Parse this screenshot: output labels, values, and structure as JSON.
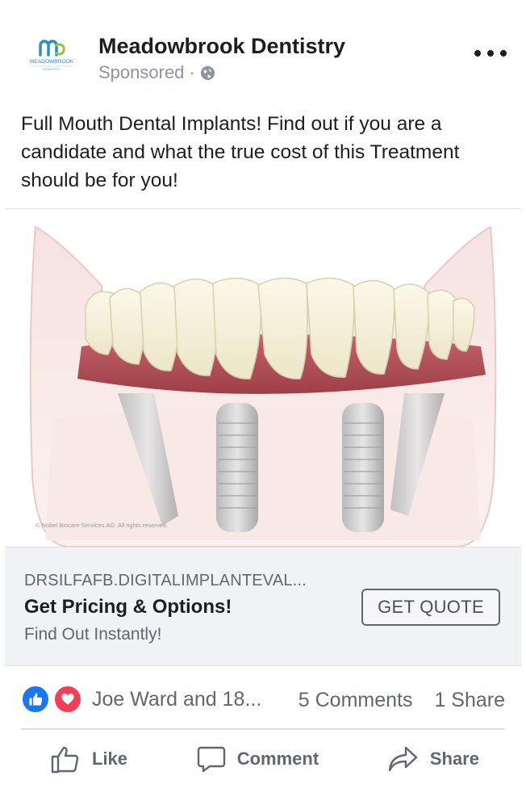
{
  "page": {
    "name": "Meadowbrook Dentistry",
    "sponsored_label": "Sponsored",
    "separator": "·",
    "logo_text": "MEADOWBROOK",
    "logo_subtext": "DENTISTRY"
  },
  "post": {
    "text": "Full Mouth Dental Implants! Find out if you are a candidate and what the true cost of this Treatment should be for you!"
  },
  "media": {
    "copyright": "© Nobel Biocare Services AG. All rights reserved."
  },
  "link": {
    "domain": "DRSILFAFB.DIGITALIMPLANTEVAL...",
    "title": "Get Pricing & Options!",
    "description": "Find Out Instantly!",
    "cta_label": "GET QUOTE"
  },
  "engagement": {
    "reaction_names": "Joe Ward and 18...",
    "comments": "5 Comments",
    "shares": "1 Share"
  },
  "actions": {
    "like": "Like",
    "comment": "Comment",
    "share": "Share"
  },
  "colors": {
    "brand_blue": "#1877f2",
    "love_red": "#f33e58",
    "logo_teal": "#2a8fc7",
    "gum_pink": "#b5545a"
  },
  "icons": [
    "logo-icon",
    "globe-icon",
    "more-options-icon",
    "like-reaction-icon",
    "love-reaction-icon",
    "thumbs-up-icon",
    "comment-icon",
    "share-icon"
  ]
}
